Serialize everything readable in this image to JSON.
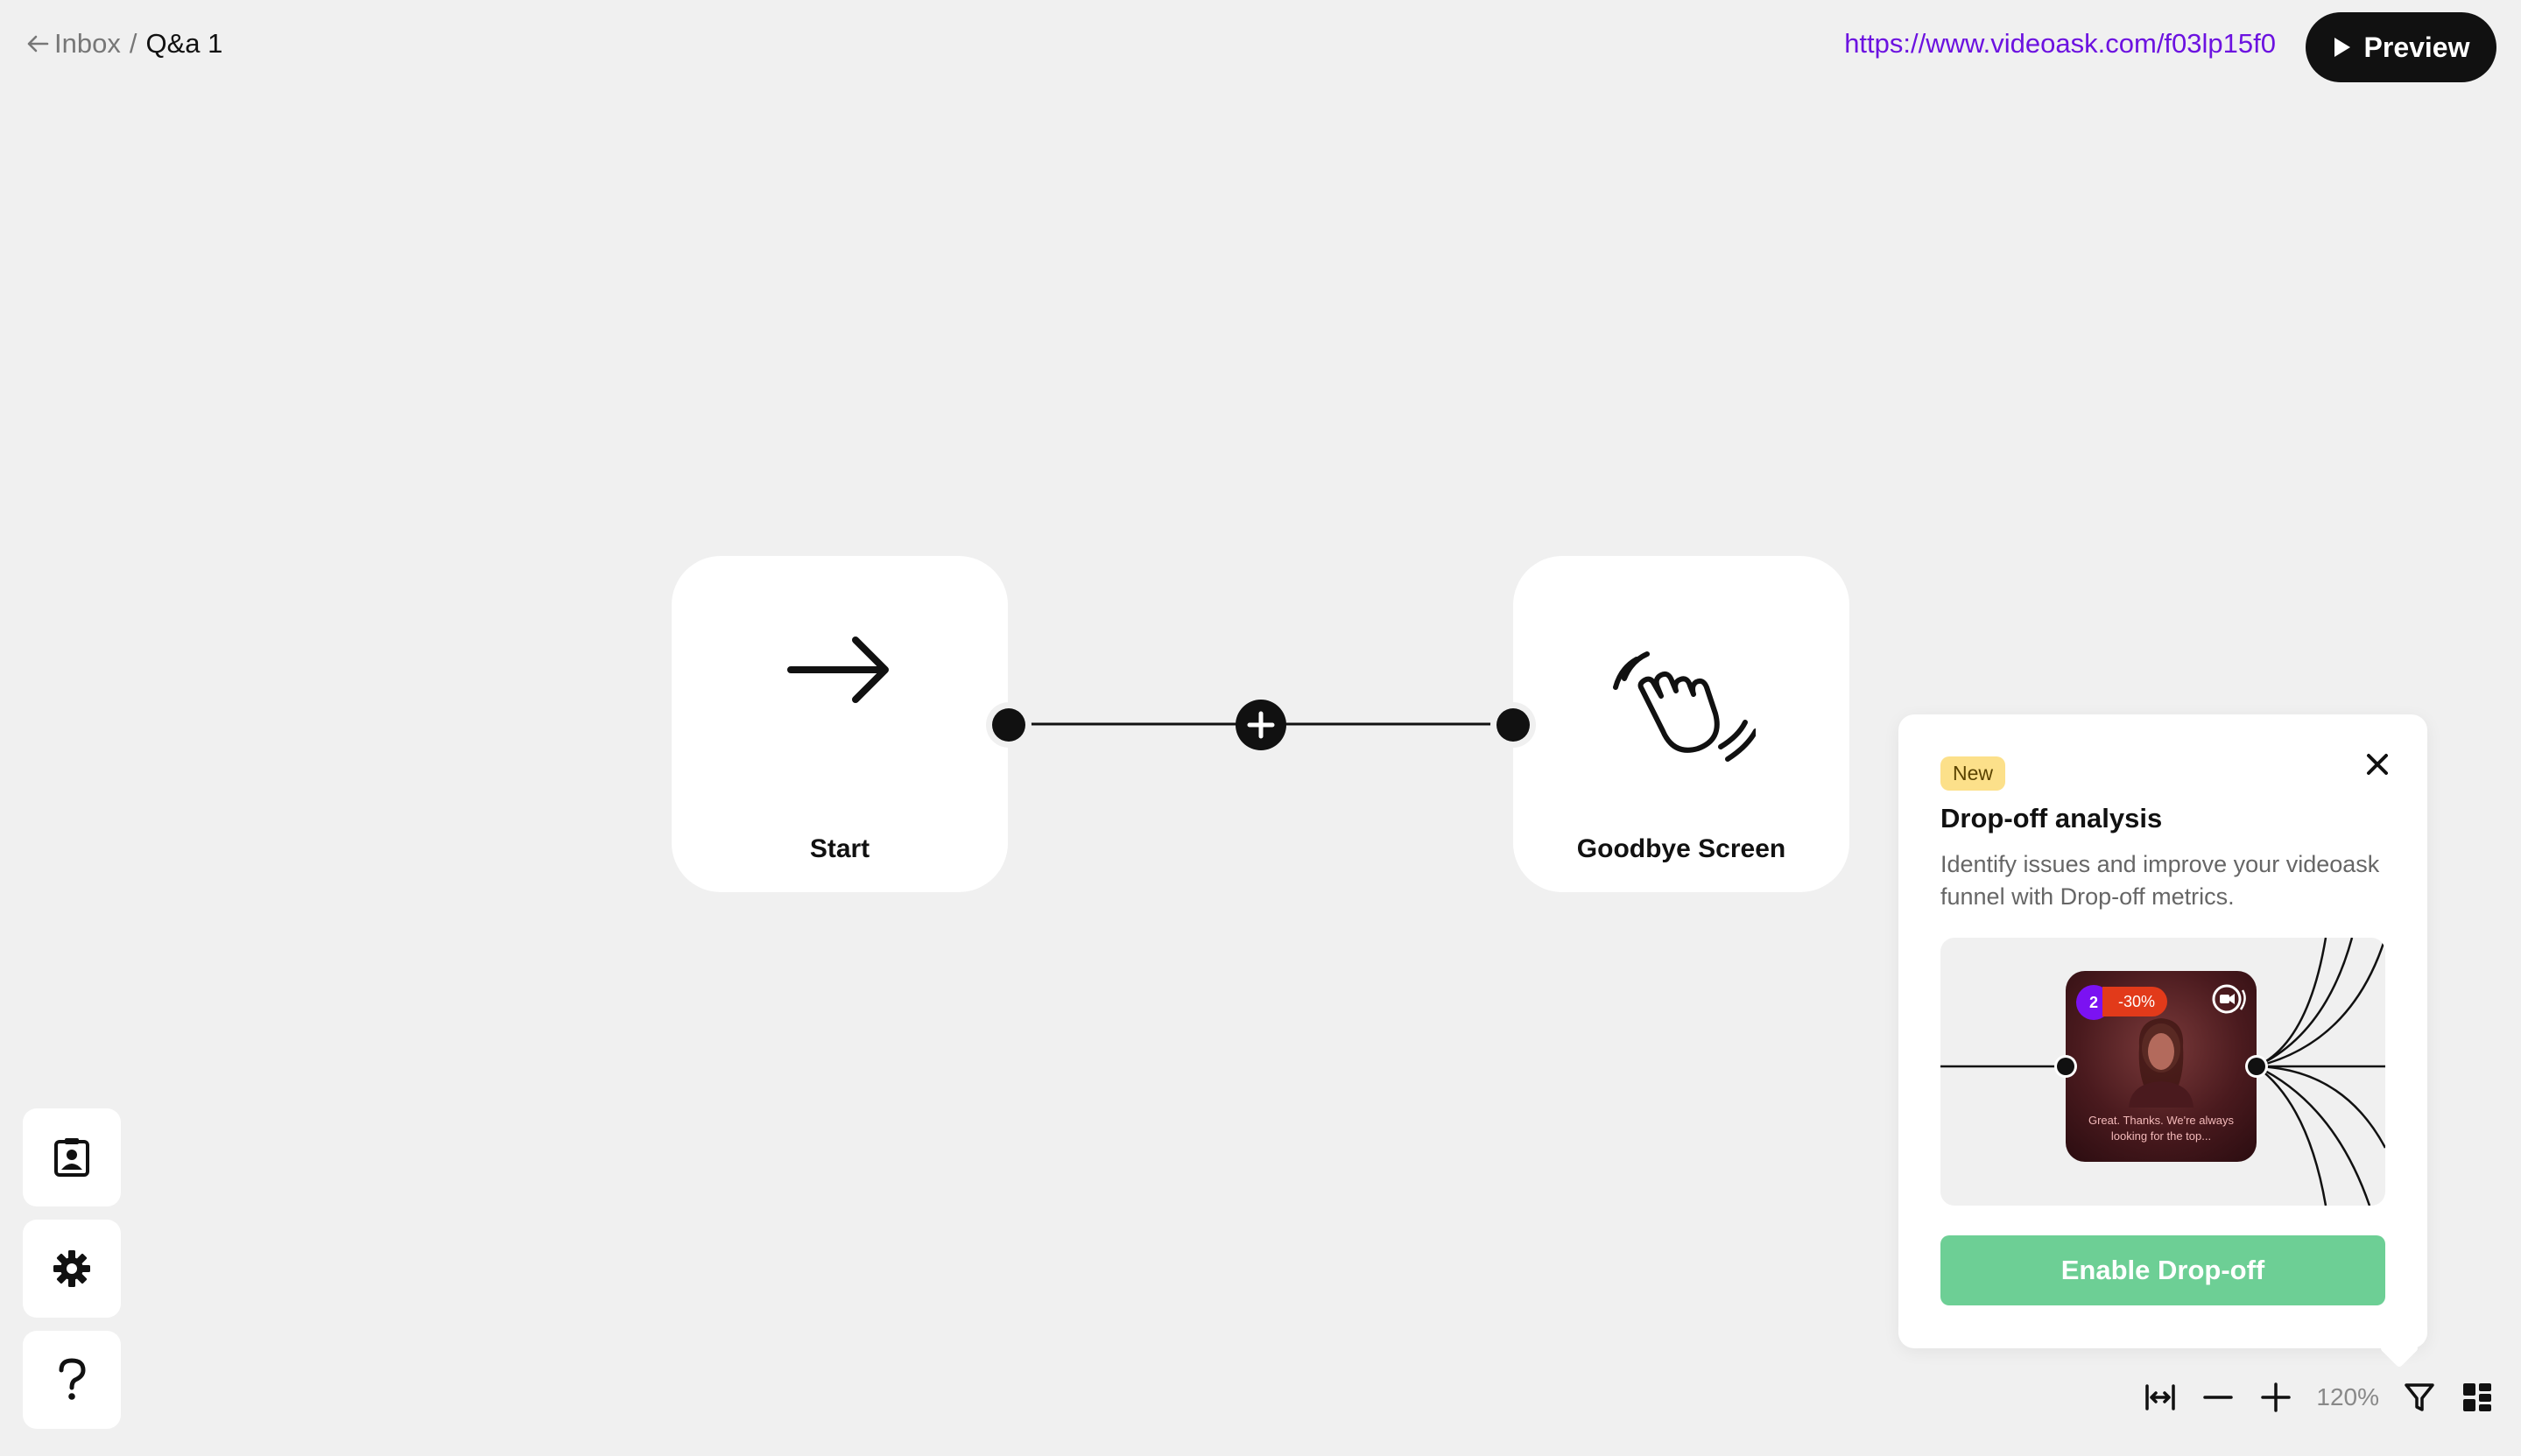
{
  "header": {
    "back_label": "Inbox",
    "separator": "/",
    "current_page": "Q&a 1",
    "share_url": "https://www.videoask.com/f03lp15f0",
    "preview_label": "Preview"
  },
  "flow": {
    "nodes": [
      {
        "label": "Start",
        "icon": "arrow-right-icon"
      },
      {
        "label": "Goodbye Screen",
        "icon": "waving-hand-icon"
      }
    ],
    "add_step_icon": "plus-icon"
  },
  "sidebar": {
    "items": [
      {
        "icon": "contacts-icon"
      },
      {
        "icon": "gear-icon"
      },
      {
        "icon": "help-icon"
      }
    ]
  },
  "popover": {
    "badge": "New",
    "title": "Drop-off analysis",
    "description": "Identify issues and improve your videoask funnel with Drop-off metrics.",
    "illustration": {
      "step_number": "2",
      "dropoff_percent": "-30%",
      "caption": "Great. Thanks. We're always looking for the top..."
    },
    "button_label": "Enable Drop-off"
  },
  "toolbar": {
    "zoom_level": "120%",
    "icons": [
      "fit-width-icon",
      "zoom-out-icon",
      "zoom-in-icon",
      "filter-icon",
      "grid-view-icon"
    ]
  },
  "colors": {
    "background": "#f0f0f0",
    "link": "#6c12e0",
    "primary_dark": "#111111",
    "enable_green": "#6dcf95",
    "badge_yellow": "#fce08a",
    "step_purple": "#7b12f2",
    "dropoff_red": "#e23a1a"
  }
}
